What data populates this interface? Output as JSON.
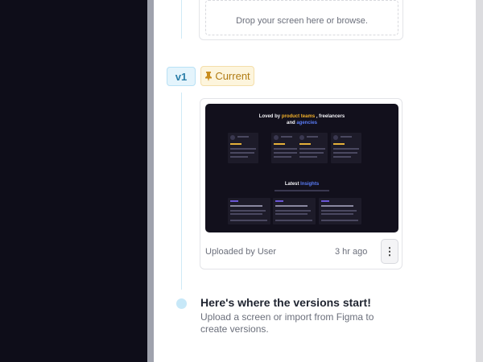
{
  "upload": {
    "drop_text": "Drop your screen here or browse."
  },
  "version": {
    "label": "v1",
    "status": "Current",
    "uploaded_by": "Uploaded by User",
    "time_ago": "3 hr ago",
    "menu_glyph": "⋮",
    "thumbnail": {
      "heading_part1": "Loved by ",
      "heading_highlight1": "product teams",
      "heading_part2": " , freelancers",
      "heading_part3": "and ",
      "heading_highlight2": "agencies",
      "section_part1": "Latest ",
      "section_highlight": "Insights"
    }
  },
  "empty_state": {
    "title": "Here's where the versions start!",
    "subtitle": "Upload a screen or import from Figma to create versions."
  },
  "colors": {
    "accent": "#c7e8f8",
    "current_badge": "#fdf5dd",
    "version_badge": "#e4f4fc"
  },
  "icons": [
    "pin-icon",
    "more-vertical-icon"
  ]
}
